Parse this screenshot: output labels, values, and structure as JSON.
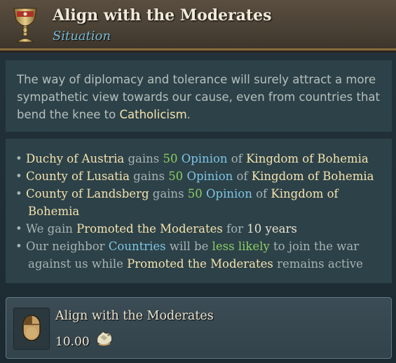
{
  "header": {
    "title": "Align with the Moderates",
    "subtitle": "Situation",
    "icon": "chalice-icon"
  },
  "description": {
    "part1": "The way of diplomacy and tolerance will surely attract a more sympathetic view towards our cause, even from countries that bend the knee to ",
    "highlight": "Catholicism",
    "part2": "."
  },
  "effects": {
    "bullet": "•",
    "e1": {
      "subject": "Duchy of Austria",
      "gains": " gains ",
      "amount": "50",
      "opinion": "Opinion",
      "of": " of ",
      "target": "Kingdom of Bohemia"
    },
    "e2": {
      "subject": "County of Lusatia",
      "gains": " gains ",
      "amount": "50",
      "opinion": "Opinion",
      "of": " of ",
      "target": "Kingdom of Bohemia"
    },
    "e3": {
      "subject": "County of Landsberg",
      "gains": " gains ",
      "amount": "50",
      "opinion": "Opinion",
      "of": " of ",
      "target_a": "Kingdom of",
      "target_b": "Bohemia"
    },
    "e4": {
      "prefix": "We gain ",
      "modifier": "Promoted the Moderates",
      "for": " for ",
      "duration": "10 years"
    },
    "e5": {
      "prefix": "Our neighbor ",
      "countries": "Countries",
      "will_be": " will be ",
      "less_likely": "less likely",
      "suffix": " to join the war",
      "line2_prefix": "against us while ",
      "modifier": "Promoted the Moderates",
      "line2_suffix": " remains active"
    }
  },
  "action": {
    "label": "Align with the Moderates",
    "cost": "10.00",
    "mouse_icon": "mouse-icon",
    "cost_icon": "diplomatic-power-icon"
  },
  "colors": {
    "header_bg": "#4a4135",
    "panel_bg": "#2d4148",
    "highlight_yellow": "#f3e3ae",
    "highlight_blue": "#7ec6e3",
    "highlight_green": "#8ccf62"
  }
}
